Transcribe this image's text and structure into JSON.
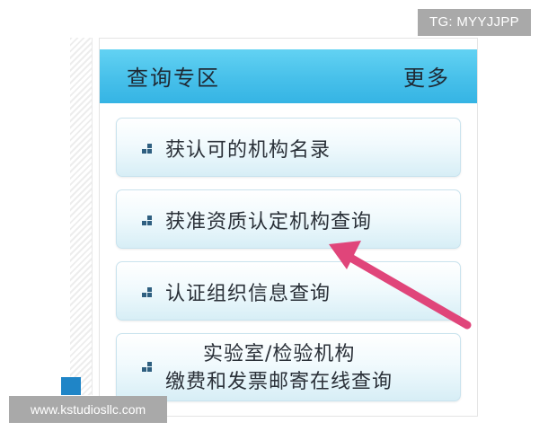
{
  "watermark": {
    "tg": "TG: MYYJJPP",
    "site": "www.kstudiosllc.com"
  },
  "panel": {
    "title": "查询专区",
    "more": "更多",
    "items": [
      {
        "label": "获认可的机构名录"
      },
      {
        "label": "获准资质认定机构查询"
      },
      {
        "label": "认证组织信息查询"
      },
      {
        "label_line1": "实验室/检验机构",
        "label_line2": "缴费和发票邮寄在线查询"
      }
    ]
  },
  "colors": {
    "header": "#47c0ea",
    "arrow": "#e0457a"
  }
}
